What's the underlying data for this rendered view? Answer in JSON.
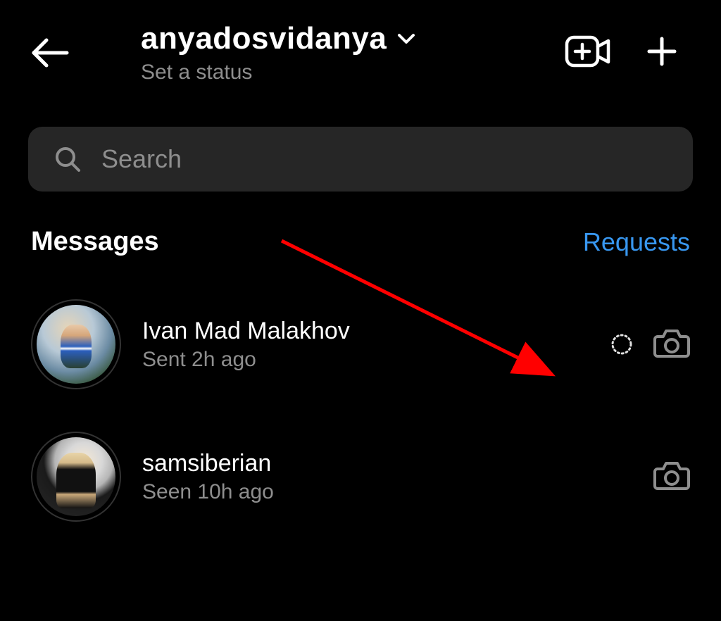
{
  "header": {
    "username": "anyadosvidanya",
    "status_prompt": "Set a status"
  },
  "search": {
    "placeholder": "Search"
  },
  "sections": {
    "messages_label": "Messages",
    "requests_label": "Requests"
  },
  "messages": [
    {
      "name": "Ivan Mad Malakhov",
      "subtitle": "Sent 2h ago",
      "has_disappearing_indicator": true
    },
    {
      "name": "samsiberian",
      "subtitle": "Seen 10h ago",
      "has_disappearing_indicator": false
    }
  ],
  "icons": {
    "back": "back-arrow-icon",
    "account_chevron": "chevron-down-icon",
    "video_call": "video-plus-icon",
    "compose": "plus-icon",
    "search": "search-icon",
    "camera": "camera-icon",
    "disappearing": "dotted-circle-icon"
  },
  "annotation": {
    "arrow_color": "#ff0000"
  }
}
